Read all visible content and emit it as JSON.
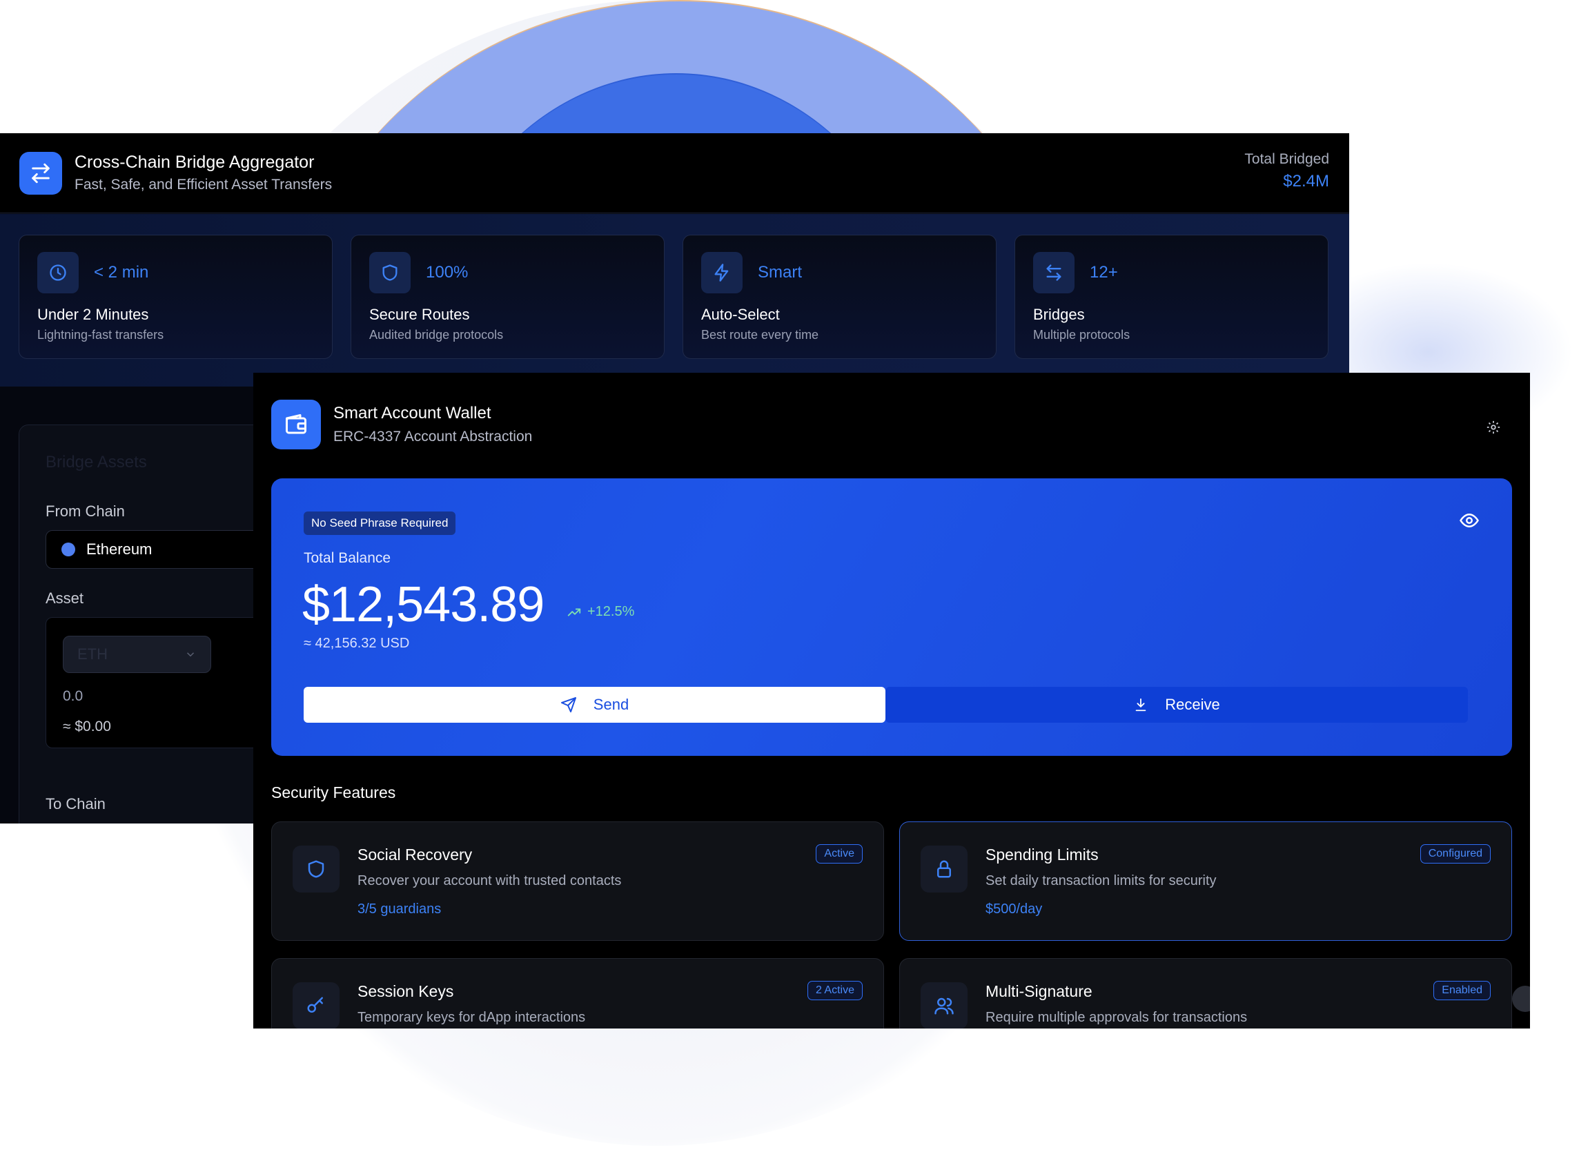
{
  "bridge": {
    "title": "Cross-Chain Bridge Aggregator",
    "subtitle": "Fast, Safe, and Efficient Asset Transfers",
    "total_label": "Total Bridged",
    "total_value": "$2.4M",
    "stats": [
      {
        "icon": "clock-icon",
        "value": "< 2 min",
        "title": "Under 2 Minutes",
        "sub": "Lightning-fast transfers"
      },
      {
        "icon": "shield-icon",
        "value": "100%",
        "title": "Secure Routes",
        "sub": "Audited bridge protocols"
      },
      {
        "icon": "lightning-icon",
        "value": "Smart",
        "title": "Auto-Select",
        "sub": "Best route every time"
      },
      {
        "icon": "arrows-swap-icon",
        "value": "12+",
        "title": "Bridges",
        "sub": "Multiple protocols"
      }
    ],
    "panel": {
      "title": "Bridge Assets",
      "from_label": "From Chain",
      "from_value": "Ethereum",
      "asset_label": "Asset",
      "asset_select": "ETH",
      "amount": "0.0",
      "usd": "≈ $0.00",
      "to_label": "To Chain"
    }
  },
  "wallet": {
    "title": "Smart Account Wallet",
    "subtitle": "ERC-4337 Account Abstraction",
    "badge": "No Seed Phrase Required",
    "balance_label": "Total Balance",
    "balance": "$12,543.89",
    "change": "+12.5%",
    "usd": "≈ 42,156.32 USD",
    "send_label": "Send",
    "receive_label": "Receive",
    "security_title": "Security Features",
    "features": [
      {
        "icon": "shield-icon",
        "title": "Social Recovery",
        "desc": "Recover your account with trusted contacts",
        "value": "3/5 guardians",
        "badge": "Active"
      },
      {
        "icon": "lock-icon",
        "title": "Spending Limits",
        "desc": "Set daily transaction limits for security",
        "value": "$500/day",
        "badge": "Configured"
      },
      {
        "icon": "key-icon",
        "title": "Session Keys",
        "desc": "Temporary keys for dApp interactions",
        "badge": "2 Active"
      },
      {
        "icon": "users-icon",
        "title": "Multi-Signature",
        "desc": "Require multiple approvals for transactions",
        "badge": "Enabled"
      }
    ]
  },
  "colors": {
    "accent": "#2f6ef7",
    "card_blue": "#1a4ee0",
    "link_blue": "#3d82f6"
  }
}
